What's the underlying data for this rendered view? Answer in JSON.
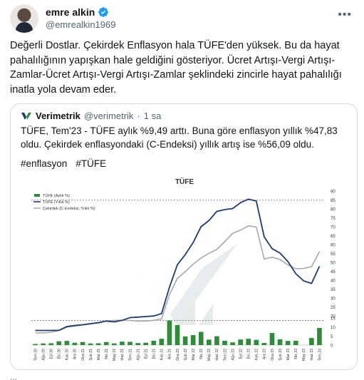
{
  "author": {
    "name": "emre alkin",
    "handle": "@emrealkin1969"
  },
  "tweet": {
    "text": "Değerli Dostlar. Çekirdek Enflasyon hala TÜFE'den yüksek. Bu da hayat pahalılığının yapışkan hale geldiğini gösteriyor. Ücret Artışı-Vergi Artışı-Zamlar-Ücret Artışı-Vergi Artışı-Zamlar şeklindeki zincirle hayat pahalılığı inatla yola devam eder."
  },
  "quote": {
    "name": "Verimetrik",
    "handle": "@verimetrik",
    "separator": "·",
    "time": "1 sa",
    "text": "TÜFE, Tem'23 - TÜFE aylık %9,49 arttı. Buna göre enflasyon yıllık %47,83 oldu. Çekirdek enflasyondaki (C-Endeksi) yıllık artış ise %56,09 oldu.",
    "hashtags": [
      "#enflasyon",
      "#TÜFE"
    ]
  },
  "footer": {
    "dots": "..."
  },
  "colors": {
    "brand_blue": "#1d9bf0",
    "navy": "#1f3a6d",
    "gray_line": "#a8a8a8",
    "green": "#2e8b3a"
  },
  "chart_data": {
    "type": "line",
    "title": "TÜFE",
    "legend": [
      "TÜFE (Aylık %)",
      "TÜFE (Yıllık %)",
      "Çekirdek (C-Endeksi, Yıllık %)"
    ],
    "legend_position": "top-left",
    "y_ticks_top": [
      90,
      85,
      80,
      75,
      70,
      65,
      60,
      55,
      50,
      45,
      40,
      35,
      30,
      25,
      20
    ],
    "y_ticks_bottom": [
      15,
      10,
      5,
      0
    ],
    "ylim_top": [
      20,
      90
    ],
    "ylim_bottom": [
      0,
      15
    ],
    "categories": [
      "Tem 20",
      "Ağu 20",
      "Eyl 20",
      "Eki 20",
      "Kas 20",
      "Ara 20",
      "Oca 21",
      "Şub 21",
      "Mar 21",
      "Nis 21",
      "May 21",
      "Haz 21",
      "Tem 21",
      "Ağu 21",
      "Eyl 21",
      "Eki 21",
      "Kas 21",
      "Ara 21",
      "Oca 22",
      "Şub 22",
      "Mar 22",
      "Nis 22",
      "May 22",
      "Haz 22",
      "Tem 22",
      "Ağu 22",
      "Eyl 22",
      "Eki 22",
      "Kas 22",
      "Ara 22",
      "Oca 23",
      "Şub 23",
      "Mar 23",
      "Nis 23",
      "May 23",
      "Haz 23",
      "Tem 23"
    ],
    "series": [
      {
        "name": "TÜFE (Aylık %)",
        "kind": "bar",
        "color": "#2e8b3a",
        "values": [
          0.6,
          0.9,
          1.0,
          2.1,
          2.3,
          1.3,
          1.7,
          0.9,
          1.0,
          1.7,
          0.9,
          1.9,
          1.8,
          1.1,
          1.3,
          2.4,
          3.5,
          13.6,
          11.1,
          4.8,
          5.5,
          7.3,
          3.0,
          4.9,
          2.4,
          1.5,
          3.1,
          3.5,
          2.9,
          1.2,
          6.7,
          3.2,
          2.3,
          2.4,
          0.0,
          3.9,
          9.5
        ]
      },
      {
        "name": "TÜFE (Yıllık %)",
        "kind": "line",
        "color": "#1f3a6d",
        "values": [
          11.8,
          11.8,
          11.8,
          11.9,
          14.0,
          14.6,
          15.0,
          15.6,
          16.2,
          17.1,
          16.6,
          17.5,
          19.0,
          19.3,
          19.6,
          19.9,
          21.3,
          36.1,
          48.7,
          54.4,
          61.1,
          70.0,
          73.5,
          78.6,
          79.6,
          80.2,
          83.5,
          85.5,
          84.4,
          64.3,
          57.7,
          55.2,
          50.5,
          43.7,
          39.6,
          38.2,
          47.8
        ]
      },
      {
        "name": "Çekirdek (C-Endeksi, Yıllık %)",
        "kind": "line",
        "color": "#a8a8a8",
        "values": [
          10.4,
          10.4,
          10.8,
          11.8,
          13.6,
          14.2,
          14.8,
          15.5,
          16.0,
          17.0,
          17.5,
          17.5,
          17.4,
          17.1,
          17.1,
          17.5,
          18.3,
          31.9,
          41.0,
          44.8,
          49.0,
          52.4,
          55.1,
          57.3,
          61.7,
          66.3,
          68.1,
          70.5,
          69.9,
          51.9,
          52.9,
          51.6,
          48.6,
          46.4,
          46.6,
          47.6,
          56.1
        ]
      }
    ]
  }
}
